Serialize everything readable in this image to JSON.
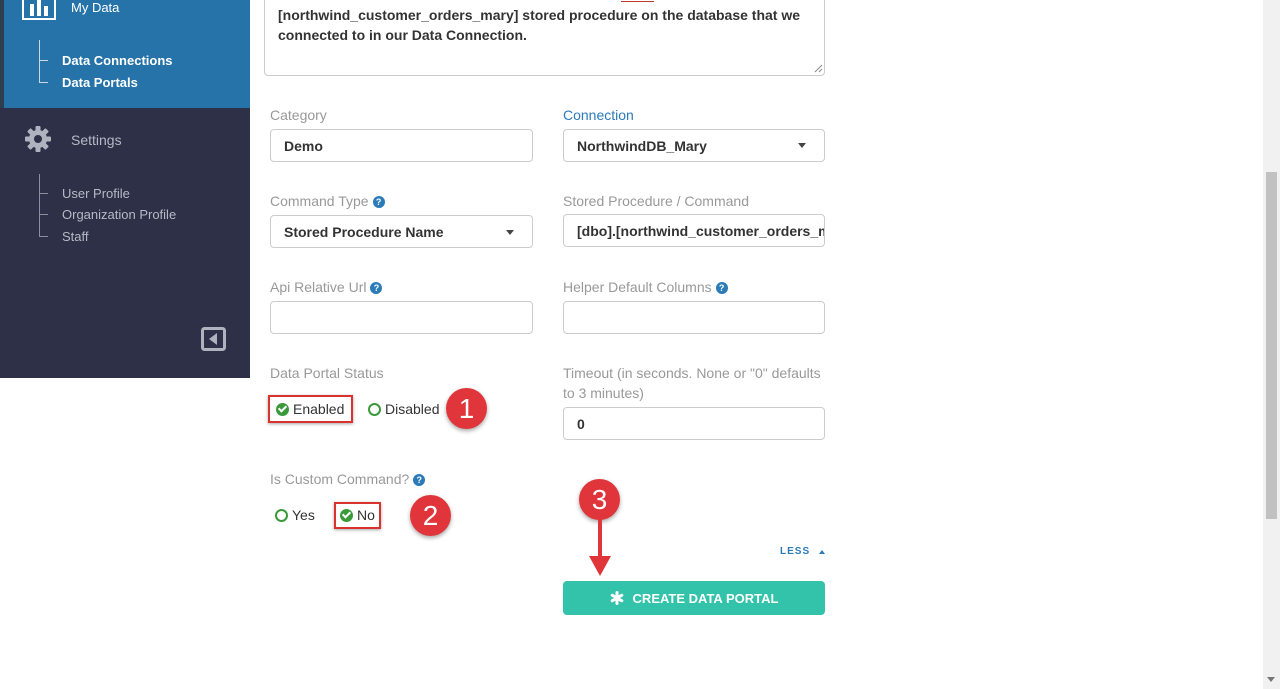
{
  "sidebar": {
    "my_data": "My Data",
    "data_connections": "Data Connections",
    "data_portals": "Data Portals",
    "settings": "Settings",
    "user_profile": "User Profile",
    "organization_profile": "Organization Profile",
    "staff": "Staff"
  },
  "description": {
    "line1": "[northwind_customer_orders_mary] stored procedure on the database that we",
    "line2": "connected to in our Data Connection."
  },
  "form": {
    "category_label": "Category",
    "category_value": "Demo",
    "connection_label": "Connection",
    "connection_value": "NorthwindDB_Mary",
    "command_type_label": "Command Type",
    "command_type_value": "Stored Procedure Name",
    "stored_proc_label": "Stored Procedure / Command",
    "stored_proc_value": "[dbo].[northwind_customer_orders_mary]",
    "api_url_label": "Api Relative Url",
    "api_url_value": "",
    "helper_cols_label": "Helper Default Columns",
    "helper_cols_value": "",
    "status_label": "Data Portal Status",
    "status_enabled": "Enabled",
    "status_disabled": "Disabled",
    "status_selected": "Enabled",
    "timeout_label_line1": "Timeout (in seconds. None or \"0\" defaults",
    "timeout_label_line2": "to 3 minutes)",
    "timeout_value": "0",
    "custom_cmd_label": "Is Custom Command?",
    "custom_yes": "Yes",
    "custom_no": "No",
    "custom_selected": "No",
    "less_label": "LESS",
    "create_button": "CREATE DATA PORTAL",
    "help_glyph": "?"
  },
  "annotations": {
    "badge1": "1",
    "badge2": "2",
    "badge3": "3"
  },
  "colors": {
    "sidebar_active": "#2573a8",
    "sidebar_dark": "#2d3047",
    "accent_teal": "#33c3aa",
    "annotation_red": "#e0353a",
    "label_blue": "#2b7bb9"
  }
}
